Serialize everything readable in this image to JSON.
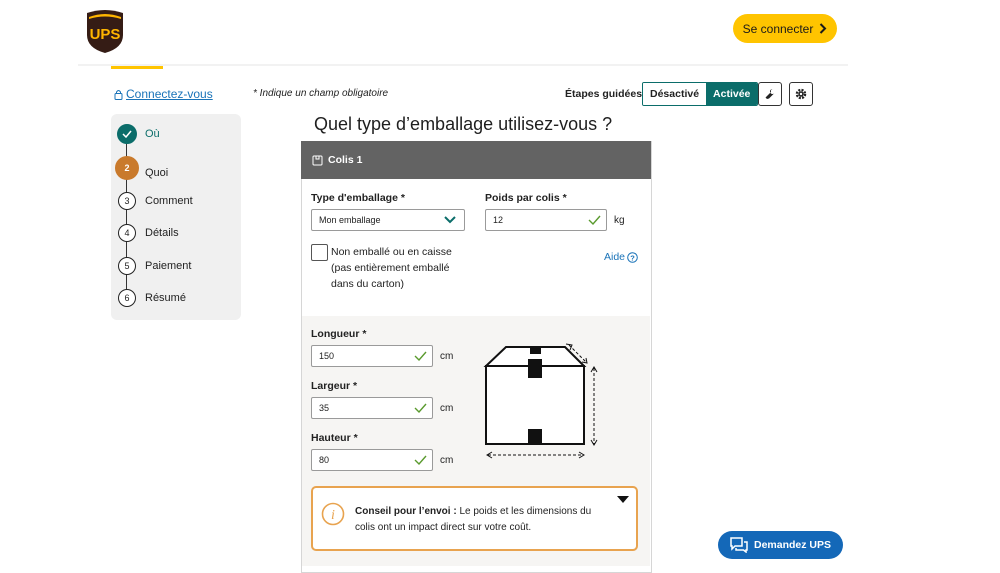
{
  "header": {
    "logo_text": "UPS",
    "signin_label": "Se connecter"
  },
  "subheader": {
    "connect_link": "Connectez-vous",
    "required_note": "* Indique un champ obligatoire",
    "guided_label": "Étapes guidées",
    "toggle_off": "Désactivé",
    "toggle_on": "Activée"
  },
  "steps": [
    {
      "num": "",
      "label": "Où",
      "state": "done"
    },
    {
      "num": "2",
      "label": "Quoi",
      "state": "current"
    },
    {
      "num": "3",
      "label": "Comment",
      "state": "todo"
    },
    {
      "num": "4",
      "label": "Détails",
      "state": "todo"
    },
    {
      "num": "5",
      "label": "Paiement",
      "state": "todo"
    },
    {
      "num": "6",
      "label": "Résumé",
      "state": "todo"
    }
  ],
  "main": {
    "title": "Quel type d’emballage utilisez-vous ?",
    "package_title": "Colis 1",
    "packaging_type_label": "Type d'emballage *",
    "packaging_type_value": "Mon emballage",
    "weight_label": "Poids par colis *",
    "weight_value": "12",
    "weight_unit": "kg",
    "unpacked_text": "Non emballé ou en caisse (pas entièrement emballé dans du carton)",
    "help_label": "Aide",
    "length_label": "Longueur *",
    "length_value": "150",
    "width_label": "Largeur *",
    "width_value": "35",
    "height_label": "Hauteur *",
    "height_value": "80",
    "dim_unit": "cm",
    "tip_bold": "Conseil pour l’envoi :",
    "tip_text": " Le poids et les dimensions du colis ont un impact direct sur votre coût."
  },
  "chat": {
    "label": "Demandez UPS"
  },
  "colors": {
    "accent": "#ffc400",
    "teal": "#0b6d6a",
    "brown": "#c97a2c",
    "link": "#1a73b8",
    "tip_border": "#e8a34f"
  }
}
